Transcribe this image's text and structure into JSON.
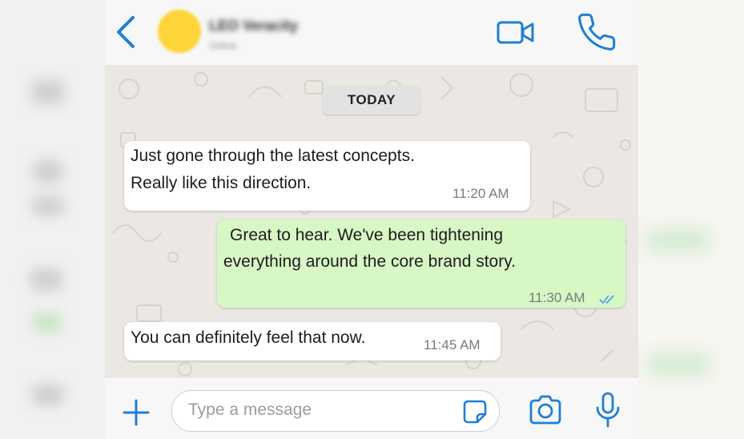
{
  "colors": {
    "accent": "#1f7fd6",
    "header_bg": "#f7f7f7",
    "chat_bg": "#ebe8e3",
    "incoming_bubble": "#ffffff",
    "outgoing_bubble": "#d7f7c4",
    "avatar": "#fed538",
    "read_ticks": "#4da3e8"
  },
  "header": {
    "back_icon": "chevron-left-icon",
    "contact_name": "LEO Veracity",
    "contact_status": "Online",
    "video_icon": "video-camera-icon",
    "call_icon": "phone-icon"
  },
  "chat": {
    "date_separator": "TODAY",
    "messages": [
      {
        "direction": "incoming",
        "lines": [
          "Just gone through the latest concepts.",
          "Really like this direction."
        ],
        "time": "11:20 AM"
      },
      {
        "direction": "outgoing",
        "lines": [
          "Great to hear. We've been tightening",
          "everything around the core brand story."
        ],
        "time": "11:30 AM",
        "status": "read"
      },
      {
        "direction": "incoming",
        "lines": [
          "You can definitely feel that now."
        ],
        "time": "11:45 AM"
      }
    ]
  },
  "composer": {
    "attach_icon": "plus-icon",
    "placeholder": "Type a message",
    "value": "",
    "sticker_icon": "sticker-icon",
    "camera_icon": "camera-icon",
    "mic_icon": "microphone-icon"
  }
}
